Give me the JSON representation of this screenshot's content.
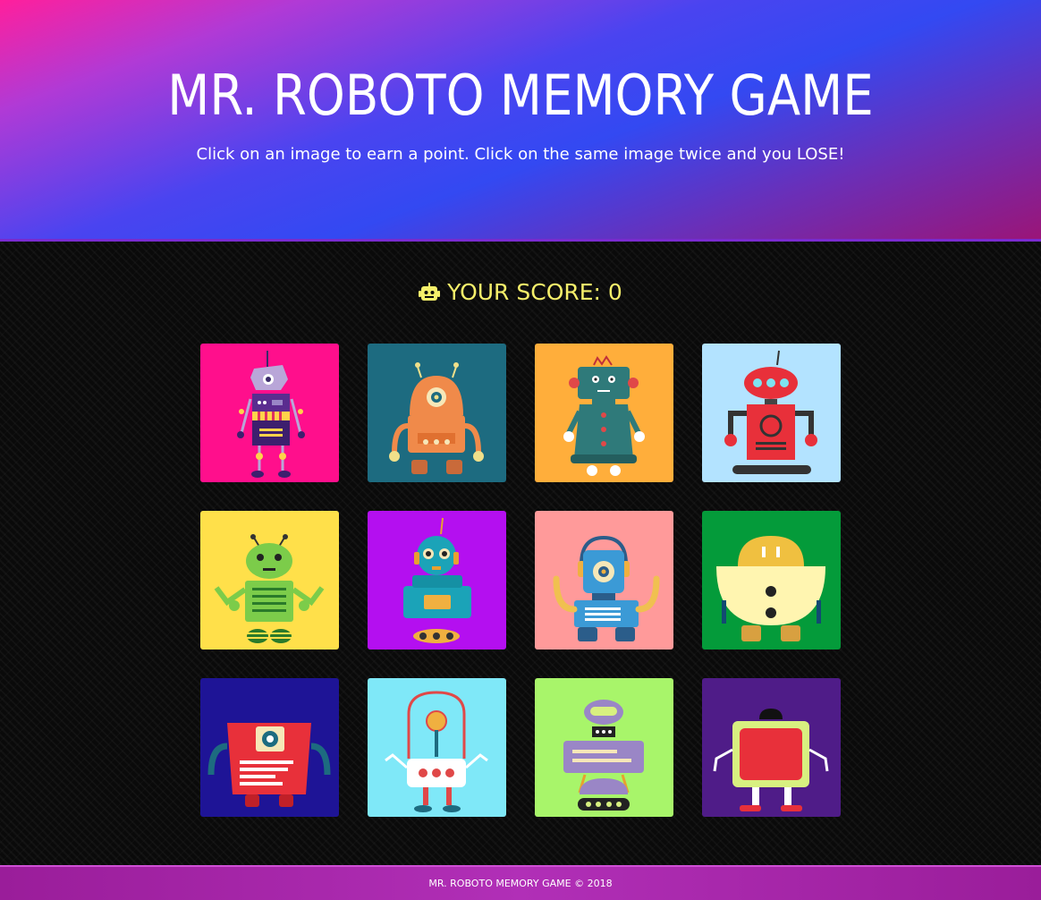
{
  "header": {
    "title": "MR. ROBOTO MEMORY GAME",
    "subtitle": "Click on an image to earn a point. Click on the same image twice and you LOSE!"
  },
  "score": {
    "label": "YOUR SCORE:",
    "value": "0",
    "icon": "robot-icon",
    "color": "#f5ef6a"
  },
  "cards": [
    {
      "name": "robot-card-1",
      "bg": "#ff0f8c"
    },
    {
      "name": "robot-card-2",
      "bg": "#1d6b80"
    },
    {
      "name": "robot-card-3",
      "bg": "#ffae3b"
    },
    {
      "name": "robot-card-4",
      "bg": "#b3e3ff"
    },
    {
      "name": "robot-card-5",
      "bg": "#ffe04a"
    },
    {
      "name": "robot-card-6",
      "bg": "#b40ff0"
    },
    {
      "name": "robot-card-7",
      "bg": "#ff9a9a"
    },
    {
      "name": "robot-card-8",
      "bg": "#049b3a"
    },
    {
      "name": "robot-card-9",
      "bg": "#1e1496"
    },
    {
      "name": "robot-card-10",
      "bg": "#7fe8f8"
    },
    {
      "name": "robot-card-11",
      "bg": "#a8f56a"
    },
    {
      "name": "robot-card-12",
      "bg": "#4f1c88"
    }
  ],
  "footer": {
    "text": "MR. ROBOTO MEMORY GAME © 2018"
  }
}
